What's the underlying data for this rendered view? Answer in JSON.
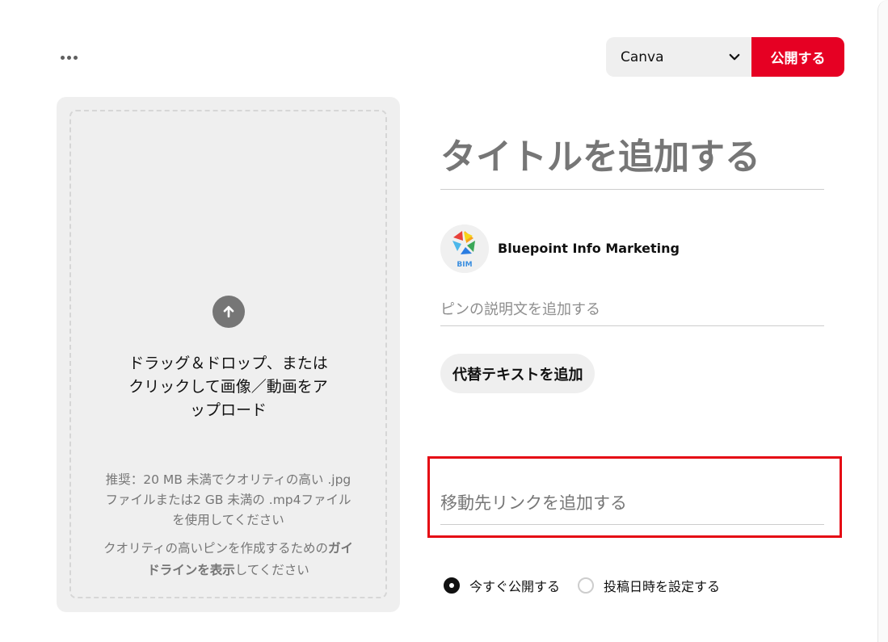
{
  "header": {
    "board_select": {
      "value": "Canva"
    },
    "publish_label": "公開する"
  },
  "upload": {
    "main_lines": [
      "ドラッグ＆ドロップ、または",
      "クリックして画像／動画をア",
      "ップロード"
    ],
    "hint_lines": [
      "推奨：20 MB 未満でクオリティの高い .jpg",
      "ファイルまたは2 GB 未満の .mp4ファイル",
      "を使用してください"
    ],
    "guide_prefix": "クオリティの高いピンを作成するための",
    "guide_link_1": "ガイ",
    "guide_link_2": "ドラインを表示",
    "guide_suffix": "してください"
  },
  "pin_form": {
    "title_placeholder": "タイトルを追加する",
    "account_name": "Bluepoint Info Marketing",
    "avatar_text": "BIM",
    "description_placeholder": "ピンの説明文を追加する",
    "alt_text_button": "代替テキストを追加",
    "link_placeholder": "移動先リンクを追加する"
  },
  "publish_options": [
    {
      "label": "今すぐ公開する",
      "selected": true
    },
    {
      "label": "投稿日時を設定する",
      "selected": false
    }
  ],
  "colors": {
    "accent": "#e60023",
    "highlight": "#e50914"
  }
}
